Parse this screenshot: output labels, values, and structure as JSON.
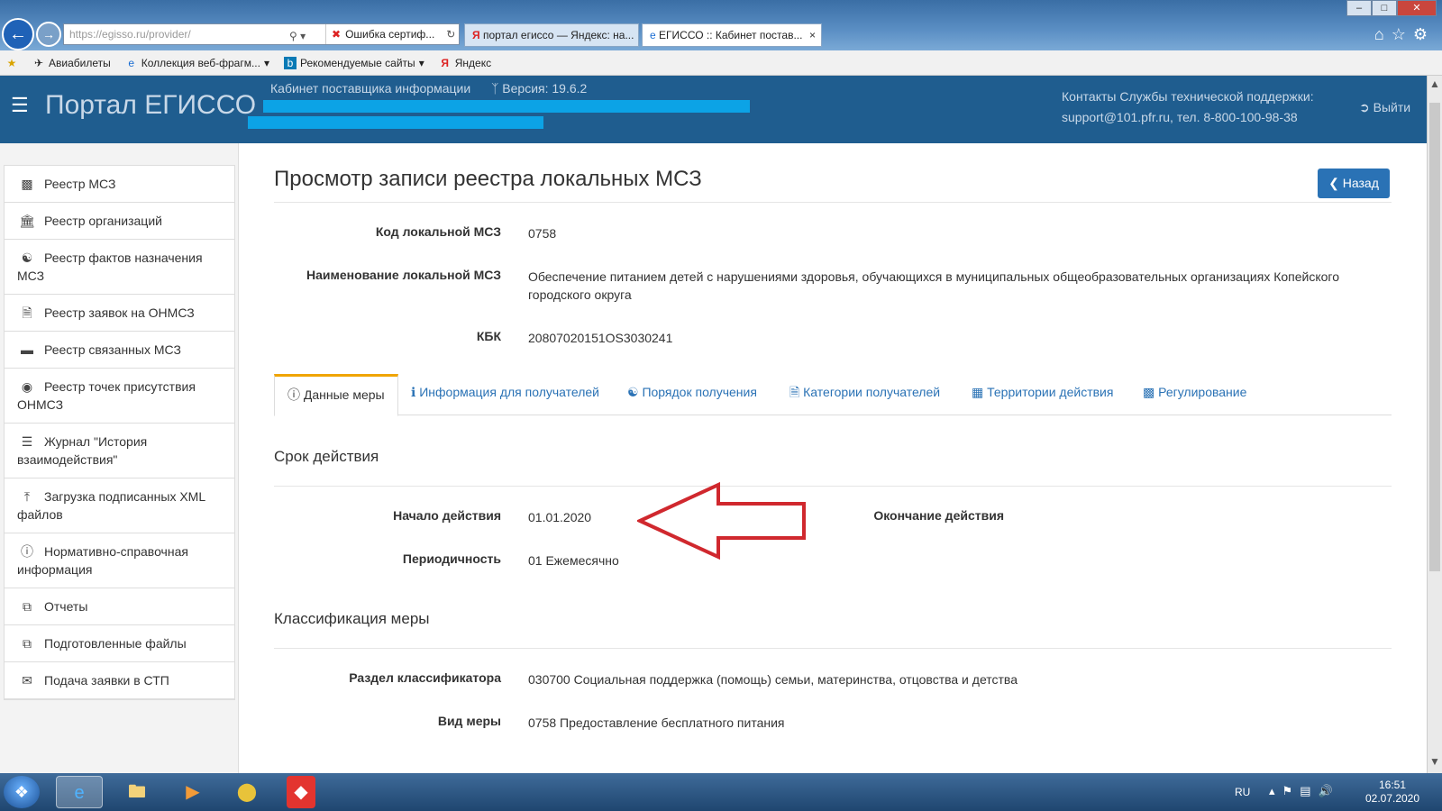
{
  "browser": {
    "address": "https://egisso.ru/provider/",
    "address_host": "egisso.ru",
    "cert_tab": "Ошибка сертиф...",
    "tabs": [
      {
        "title": "портал егиссо — Яндекс: на..."
      },
      {
        "title": "ЕГИССО :: Кабинет постав..."
      }
    ],
    "favorites": [
      "Авиабилеты",
      "Коллекция веб-фрагм...",
      "Рекомендуемые сайты",
      "Яндекс"
    ]
  },
  "header": {
    "brand": "Портал ЕГИССО",
    "cabinet": "Кабинет поставщика информации",
    "version": "Версия: 19.6.2",
    "support_line1": "Контакты Службы технической поддержки:",
    "support_line2": "support@101.pfr.ru, тел. 8-800-100-98-38",
    "logout": "Выйти"
  },
  "sidebar": {
    "items": [
      {
        "label": "Реестр МСЗ",
        "icon": "book-icon"
      },
      {
        "label": "Реестр организаций",
        "icon": "bank-icon"
      },
      {
        "label": "Реестр фактов назначения МСЗ",
        "icon": "handshake-icon"
      },
      {
        "label": "Реестр заявок на ОНМСЗ",
        "icon": "file-icon"
      },
      {
        "label": "Реестр связанных МСЗ",
        "icon": "card-icon"
      },
      {
        "label": "Реестр точек присутствия ОНМСЗ",
        "icon": "target-icon"
      },
      {
        "label": "Журнал \"История взаимодействия\"",
        "icon": "list-icon"
      },
      {
        "label": "Загрузка подписанных XML файлов",
        "icon": "upload-icon"
      },
      {
        "label": "Нормативно-справочная информация",
        "icon": "info-icon"
      },
      {
        "label": "Отчеты",
        "icon": "copy-icon"
      },
      {
        "label": "Подготовленные файлы",
        "icon": "copy-icon"
      },
      {
        "label": "Подача заявки в СТП",
        "icon": "envelope-icon"
      }
    ]
  },
  "main": {
    "title": "Просмотр записи реестра локальных МСЗ",
    "back_label": "Назад",
    "fields": {
      "code_label": "Код локальной МСЗ",
      "code_value": "0758",
      "name_label": "Наименование локальной МСЗ",
      "name_value": "Обеспечение питанием детей с нарушениями здоровья, обучающихся в муниципальных общеобразовательных организациях Копейского городского округа",
      "kbk_label": "КБК",
      "kbk_value": "20807020151OS3030241"
    },
    "tabs": [
      {
        "label": "Данные меры",
        "icon": "info-circle-icon"
      },
      {
        "label": "Информация для получателей",
        "icon": "info-icon"
      },
      {
        "label": "Порядок получения",
        "icon": "handshake-icon"
      },
      {
        "label": "Категории получателей",
        "icon": "file-icon"
      },
      {
        "label": "Территории действия",
        "icon": "sitemap-icon"
      },
      {
        "label": "Регулирование",
        "icon": "book-icon"
      }
    ],
    "validity": {
      "title": "Срок действия",
      "start_label": "Начало действия",
      "start_value": "01.01.2020",
      "end_label": "Окончание действия",
      "period_label": "Периодичность",
      "period_value": "01 Ежемесячно"
    },
    "classification": {
      "title": "Классификация меры",
      "section_label": "Раздел классификатора",
      "section_value": "030700 Социальная поддержка (помощь) семьи, материнства, отцовства и детства",
      "kind_label": "Вид меры",
      "kind_value": "0758 Предоставление бесплатного питания"
    }
  },
  "taskbar": {
    "lang": "RU",
    "time": "16:51",
    "date": "02.07.2020"
  },
  "colors": {
    "header_bg": "#1f5d8f",
    "accent_blue": "#2a72b5",
    "tab_active_border": "#f0a500",
    "annotation_red": "#d0282e",
    "redaction": "#0ca3e6"
  }
}
